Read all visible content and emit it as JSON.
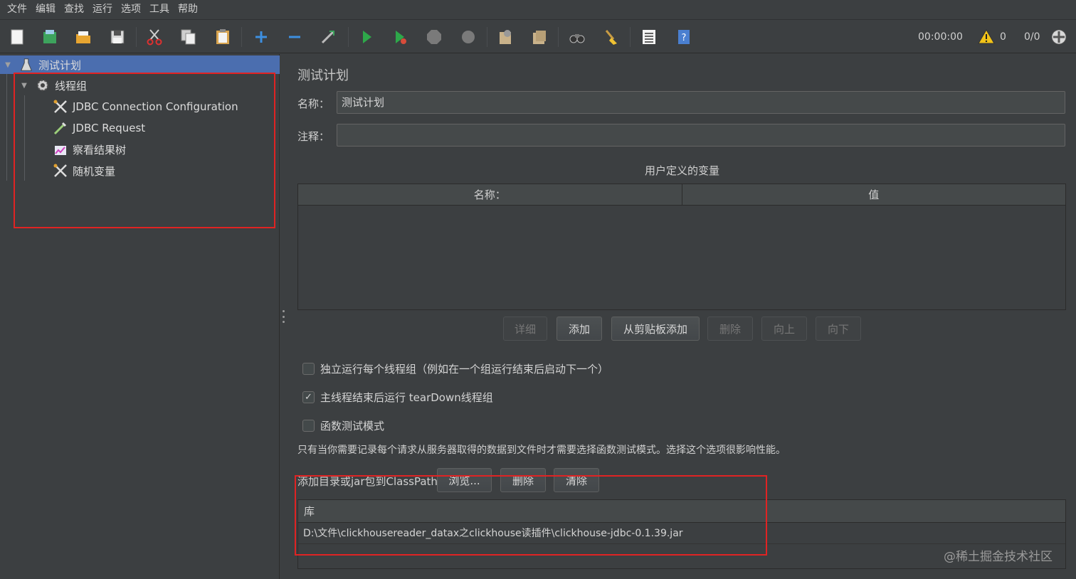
{
  "menu": [
    "文件",
    "编辑",
    "查找",
    "运行",
    "选项",
    "工具",
    "帮助"
  ],
  "toolbar": {
    "timer": "00:00:00",
    "warnings": "0",
    "threads": "0/0",
    "icons": [
      "new-icon",
      "templates-icon",
      "open-icon",
      "save-icon",
      "cut-icon",
      "copy-icon",
      "paste-icon",
      "expand-icon",
      "collapse-icon",
      "toggle-icon",
      "start-icon",
      "start-no-pause-icon",
      "stop-icon",
      "shutdown-icon",
      "clear-icon",
      "clear-all-icon",
      "search-icon",
      "reset-search-icon",
      "function-helper-icon",
      "help-icon",
      "warning-icon",
      "remote-icon"
    ]
  },
  "tree": {
    "plan": "测试计划",
    "thread_group": "线程组",
    "items": [
      "JDBC Connection Configuration",
      "JDBC Request",
      "察看结果树",
      "随机变量"
    ]
  },
  "main": {
    "title": "测试计划",
    "name_label": "名称：",
    "name_value": "测试计划",
    "comment_label": "注释：",
    "comment_value": "",
    "vars_title": "用户定义的变量",
    "vars_columns": [
      "名称：",
      "值"
    ],
    "buttons": {
      "detail": "详细",
      "add": "添加",
      "add_clipboard": "从剪贴板添加",
      "delete": "删除",
      "up": "向上",
      "down": "向下"
    },
    "checks": [
      {
        "label": "独立运行每个线程组（例如在一个组运行结束后启动下一个）",
        "checked": false
      },
      {
        "label": "主线程结束后运行 tearDown线程组",
        "checked": true
      },
      {
        "label": "函数测试模式",
        "checked": false
      }
    ],
    "func_note": "只有当你需要记录每个请求从服务器取得的数据到文件时才需要选择函数测试模式。选择这个选项很影响性能。",
    "classpath_label": "添加目录或jar包到ClassPath",
    "classpath_buttons": {
      "browse": "浏览...",
      "delete": "删除",
      "clear": "清除"
    },
    "lib_header": "库",
    "lib_rows": [
      "D:\\文件\\clickhousereader_datax之clickhouse读插件\\clickhouse-jdbc-0.1.39.jar"
    ]
  },
  "watermark": "@稀土掘金技术社区",
  "colors": {
    "accent": "#4b6eaf",
    "highlight_box": "#e02323",
    "background": "#3c3f41"
  }
}
